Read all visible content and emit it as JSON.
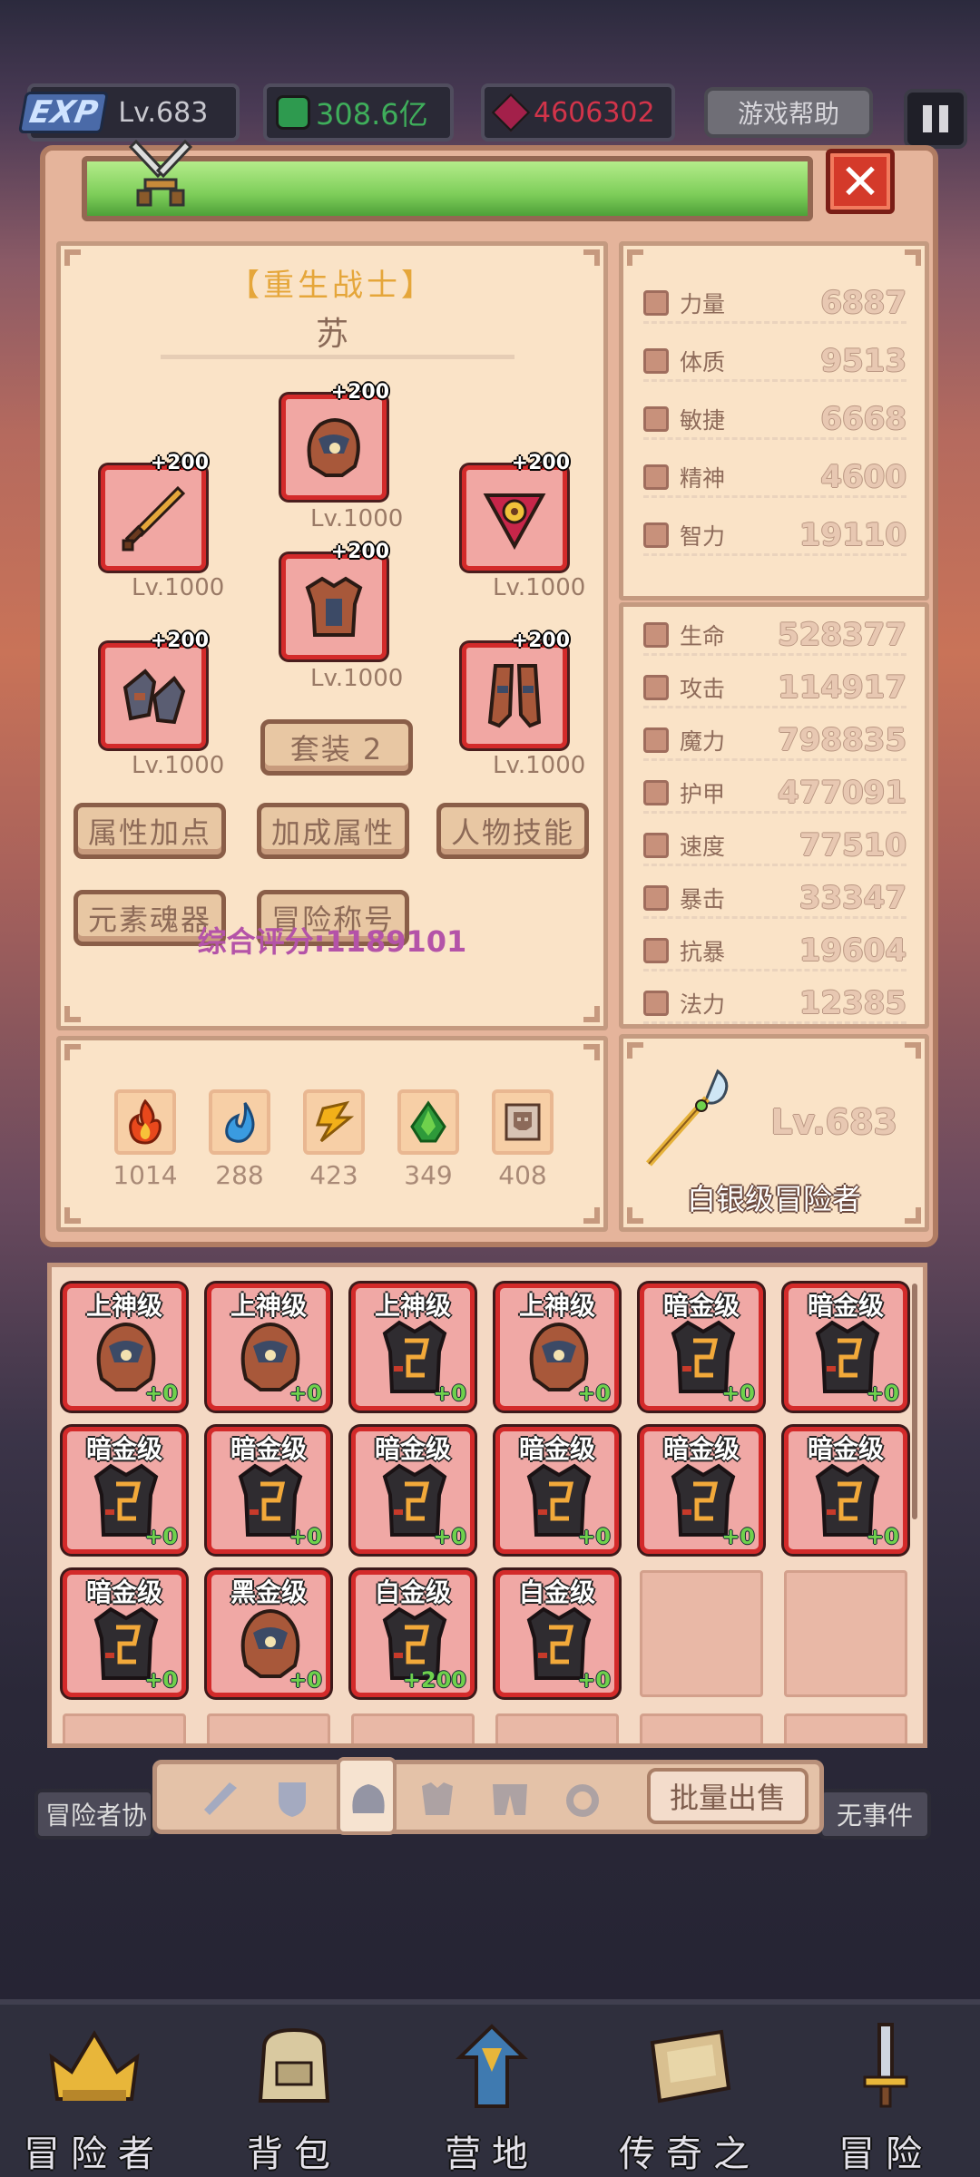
{
  "topbar": {
    "exp_badge": "EXP",
    "exp_level": "Lv.683",
    "gold": "308.6亿",
    "gems": "4606302",
    "help_label": "游戏帮助"
  },
  "character": {
    "title": "【重生战士】",
    "name": "苏",
    "equipment": [
      {
        "slot": "helmet",
        "plus": "+200",
        "level": "Lv.1000"
      },
      {
        "slot": "weapon",
        "plus": "+200",
        "level": "Lv.1000"
      },
      {
        "slot": "amulet",
        "plus": "+200",
        "level": "Lv.1000"
      },
      {
        "slot": "armor",
        "plus": "+200",
        "level": "Lv.1000"
      },
      {
        "slot": "gloves",
        "plus": "+200",
        "level": "Lv.1000"
      },
      {
        "slot": "boots",
        "plus": "+200",
        "level": "Lv.1000"
      }
    ],
    "set_label": "套装 2",
    "buttons": [
      "属性加点",
      "加成属性",
      "人物技能",
      "元素魂器",
      "冒险称号"
    ],
    "score": "综合评分:1189101"
  },
  "elements": [
    {
      "icon": "fire-icon",
      "value": "1014",
      "color": "#e8481c"
    },
    {
      "icon": "water-icon",
      "value": "288",
      "color": "#3a9be0"
    },
    {
      "icon": "lightning-icon",
      "value": "423",
      "color": "#f2b019"
    },
    {
      "icon": "earth-icon",
      "value": "349",
      "color": "#2e9a3a"
    },
    {
      "icon": "skull-icon",
      "value": "408",
      "color": "#8c6a5a"
    }
  ],
  "attributes": [
    {
      "label": "力量",
      "value": "6887"
    },
    {
      "label": "体质",
      "value": "9513"
    },
    {
      "label": "敏捷",
      "value": "6668"
    },
    {
      "label": "精神",
      "value": "4600"
    },
    {
      "label": "智力",
      "value": "19110"
    }
  ],
  "stats": [
    {
      "label": "生命",
      "value": "528377"
    },
    {
      "label": "攻击",
      "value": "114917"
    },
    {
      "label": "魔力",
      "value": "798835"
    },
    {
      "label": "护甲",
      "value": "477091"
    },
    {
      "label": "速度",
      "value": "77510"
    },
    {
      "label": "暴击",
      "value": "33347"
    },
    {
      "label": "抗暴",
      "value": "19604"
    },
    {
      "label": "法力",
      "value": "12385"
    }
  ],
  "rank": {
    "level": "Lv.683",
    "title": "白银级冒险者"
  },
  "inventory": [
    {
      "grade": "上神级",
      "item": "helmet",
      "ench": "+0"
    },
    {
      "grade": "上神级",
      "item": "helmet",
      "ench": "+0"
    },
    {
      "grade": "上神级",
      "item": "dark-armor",
      "ench": "+0"
    },
    {
      "grade": "上神级",
      "item": "helmet",
      "ench": "+0"
    },
    {
      "grade": "暗金级",
      "item": "dark-armor",
      "ench": "+0"
    },
    {
      "grade": "暗金级",
      "item": "dark-armor",
      "ench": "+0"
    },
    {
      "grade": "暗金级",
      "item": "dark-armor",
      "ench": "+0"
    },
    {
      "grade": "暗金级",
      "item": "dark-armor",
      "ench": "+0"
    },
    {
      "grade": "暗金级",
      "item": "dark-armor",
      "ench": "+0"
    },
    {
      "grade": "暗金级",
      "item": "dark-armor",
      "ench": "+0"
    },
    {
      "grade": "暗金级",
      "item": "dark-armor",
      "ench": "+0"
    },
    {
      "grade": "暗金级",
      "item": "dark-armor",
      "ench": "+0"
    },
    {
      "grade": "暗金级",
      "item": "dark-armor",
      "ench": "+0"
    },
    {
      "grade": "黑金级",
      "item": "helmet",
      "ench": "+0"
    },
    {
      "grade": "白金级",
      "item": "dark-armor",
      "ench": "+200"
    },
    {
      "grade": "白金级",
      "item": "dark-armor",
      "ench": "+0"
    }
  ],
  "inventory_tabs": {
    "bulk_sell": "批量出售",
    "icons": [
      "sword-icon",
      "shield-icon",
      "helmet-icon",
      "armor-icon",
      "pants-icon",
      "ring-icon"
    ]
  },
  "side_labels": {
    "left": "冒险者协",
    "right": "无事件"
  },
  "bottom_nav": [
    {
      "label": "冒险者",
      "icon": "crown-icon"
    },
    {
      "label": "背包",
      "icon": "backpack-icon"
    },
    {
      "label": "营地",
      "icon": "camp-icon"
    },
    {
      "label": "传奇之书",
      "icon": "book-icon"
    },
    {
      "label": "冒险",
      "icon": "sword-icon"
    }
  ]
}
